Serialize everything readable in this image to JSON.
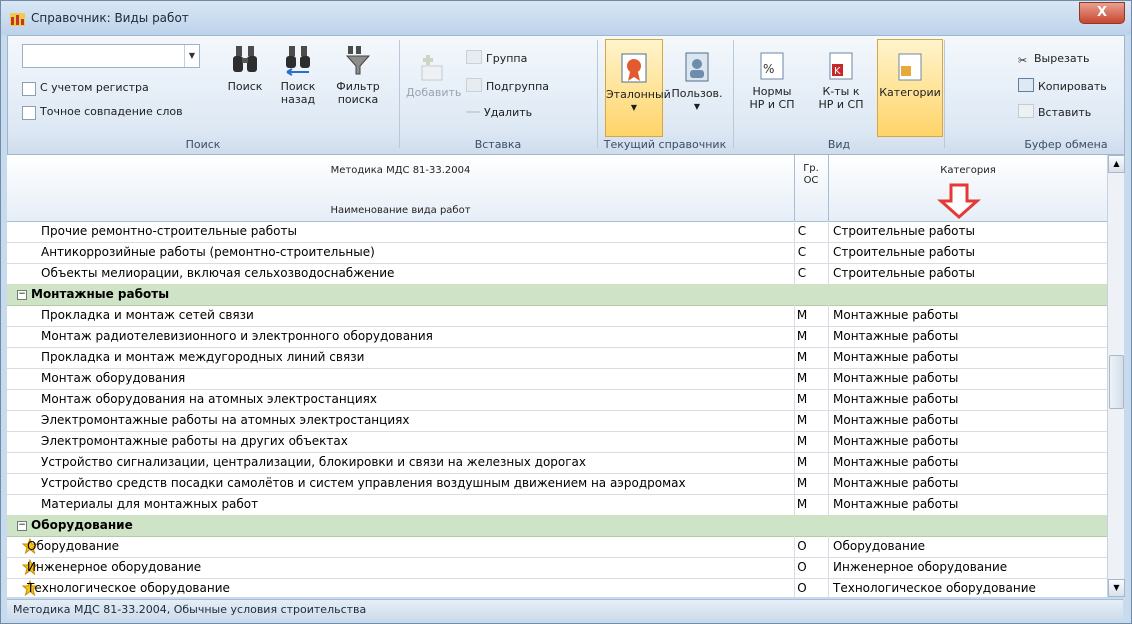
{
  "window": {
    "title": "Справочник: Виды работ",
    "close_label": "X"
  },
  "ribbon": {
    "search": {
      "combo_value": "",
      "match_case": "С учетом регистра",
      "whole_word": "Точное совпадение слов",
      "find_label": "Поиск",
      "find_back_label1": "Поиск",
      "find_back_label2": "назад",
      "filter_label1": "Фильтр",
      "filter_label2": "поиска",
      "group_label": "Поиск"
    },
    "insert": {
      "add_label": "Добавить",
      "group_btn": "Группа",
      "subgroup_btn": "Подгруппа",
      "delete_btn": "Удалить",
      "group_label": "Вставка"
    },
    "current": {
      "reference_label": "Эталонный",
      "user_label": "Пользов.",
      "group_label": "Текущий справочник"
    },
    "view": {
      "norms_label1": "Нормы",
      "norms_label2": "НР и СП",
      "coef_label1": "К-ты к",
      "coef_label2": "НР и СП",
      "categories_label": "Категории",
      "group_label": "Вид"
    },
    "clipboard": {
      "cut": "Вырезать",
      "copy": "Копировать",
      "paste": "Вставить",
      "group_label": "Буфер обмена"
    }
  },
  "grid": {
    "header_method": "Методика МДС 81-33.2004",
    "header_name": "Наименование вида работ",
    "header_gr1": "Гр.",
    "header_gr2": "ОС",
    "header_category": "Категория",
    "rows": [
      {
        "name": "Прочие ремонтно-строительные работы",
        "gr": "С",
        "cat": "Строительные работы"
      },
      {
        "name": "Антикоррозийные работы (ремонтно-строительные)",
        "gr": "С",
        "cat": "Строительные работы"
      },
      {
        "name": "Объекты мелиорации, включая сельхозводоснабжение",
        "gr": "С",
        "cat": "Строительные работы"
      },
      {
        "group": "Монтажные работы"
      },
      {
        "name": "Прокладка и монтаж сетей связи",
        "gr": "М",
        "cat": "Монтажные работы"
      },
      {
        "name": "Монтаж радиотелевизионного и электронного оборудования",
        "gr": "М",
        "cat": "Монтажные работы"
      },
      {
        "name": "Прокладка и монтаж междугородных линий связи",
        "gr": "М",
        "cat": "Монтажные работы"
      },
      {
        "name": "Монтаж оборудования",
        "gr": "М",
        "cat": "Монтажные работы"
      },
      {
        "name": "Монтаж оборудования на атомных электростанциях",
        "gr": "М",
        "cat": "Монтажные работы"
      },
      {
        "name": "Электромонтажные работы на атомных электростанциях",
        "gr": "М",
        "cat": "Монтажные работы"
      },
      {
        "name": "Электромонтажные работы на других объектах",
        "gr": "М",
        "cat": "Монтажные работы"
      },
      {
        "name": "Устройство сигнализации, централизации, блокировки и связи на железных дорогах",
        "gr": "М",
        "cat": "Монтажные работы"
      },
      {
        "name": "Устройство средств посадки самолётов и систем управления воздушным движением на аэродромах",
        "gr": "М",
        "cat": "Монтажные работы"
      },
      {
        "name": "Материалы для монтажных работ",
        "gr": "М",
        "cat": "Монтажные работы"
      },
      {
        "group": "Оборудование"
      },
      {
        "name": "Оборудование",
        "gr": "О",
        "cat": "Оборудование",
        "star": true
      },
      {
        "name": "Инженерное оборудование",
        "gr": "О",
        "cat": "Инженерное оборудование",
        "star": true
      },
      {
        "name": "Технологическое оборудование",
        "gr": "О",
        "cat": "Технологическое оборудование",
        "star": true
      }
    ]
  },
  "status": {
    "text": "Методика МДС 81-33.2004, Обычные условия строительства"
  }
}
